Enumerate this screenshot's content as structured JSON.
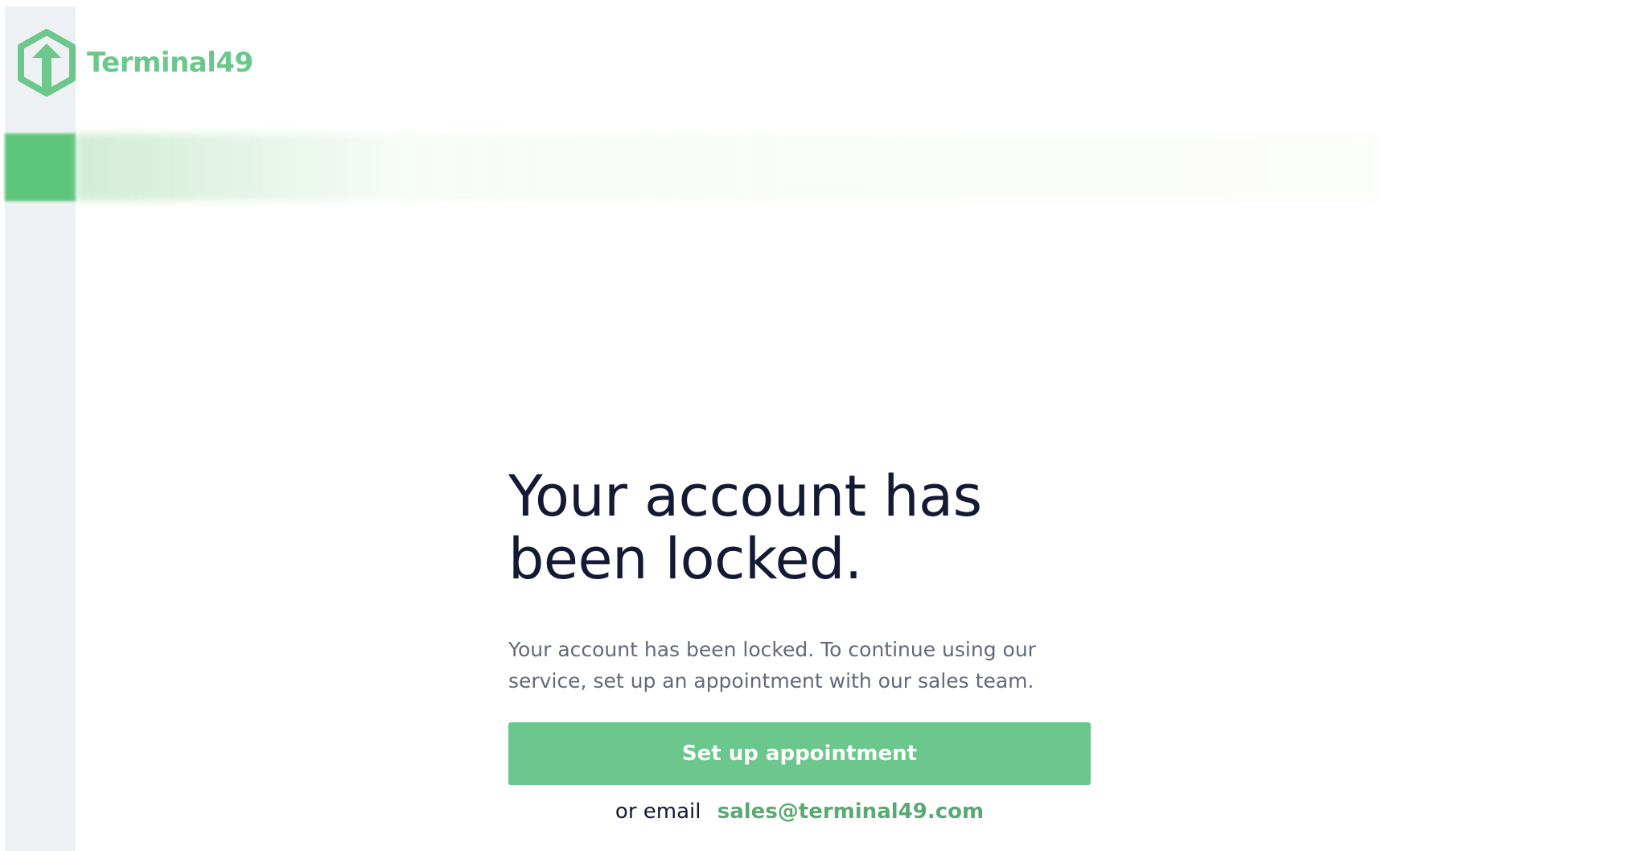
{
  "brand": {
    "name": "Terminal49",
    "color": "#6cc78c"
  },
  "locked": {
    "headline_line1": "Your account has",
    "headline_line2": "been locked.",
    "description": "Your account has been locked. To continue using our service, set up an appointment with our sales team.",
    "button_label": "Set up appointment",
    "email_prefix": "or email",
    "email_address": "sales@terminal49.com"
  },
  "colors": {
    "accent": "#6cc78c",
    "heading": "#131a33",
    "body": "#62697a",
    "rail": "#eef1f4",
    "link": "#5aa873"
  }
}
